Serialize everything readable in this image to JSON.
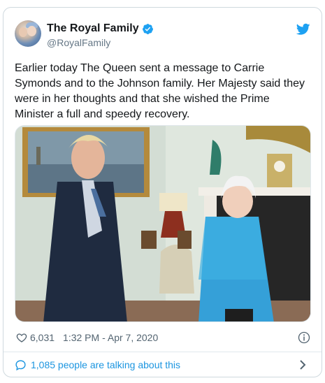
{
  "author": {
    "display_name": "The Royal Family",
    "handle": "@RoyalFamily",
    "verified_icon": "verified-badge-icon"
  },
  "brand": {
    "twitter_blue": "#1da1f2",
    "link_blue": "#1b95e0"
  },
  "tweet": {
    "text": "Earlier today The Queen sent a message to Carrie Symonds and to the Johnson family. Her Majesty said they were in her thoughts and that she wished the Prime Minister a full and speedy recovery."
  },
  "meta": {
    "like_count": "6,031",
    "timestamp": "1:32 PM - Apr 7, 2020"
  },
  "conversation": {
    "label": "1,085 people are talking about this"
  },
  "icons": {
    "like": "heart-icon",
    "info": "info-icon",
    "logo": "twitter-bird-icon",
    "conversation": "speech-bubble-icon",
    "chevron": "chevron-right-icon"
  }
}
